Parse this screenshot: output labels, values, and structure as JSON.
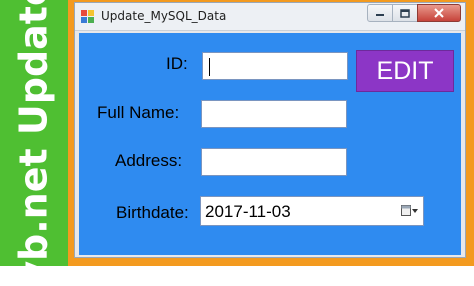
{
  "banner": {
    "text": "vb.net Update"
  },
  "window": {
    "title": "Update_MySQL_Data",
    "controls": {
      "minimize": "minimize",
      "maximize": "maximize",
      "close": "close"
    }
  },
  "form": {
    "id_label": "ID:",
    "id_value": "",
    "fullname_label": "Full Name:",
    "fullname_value": "",
    "address_label": "Address:",
    "address_value": "",
    "birthdate_label": "Birthdate:",
    "birthdate_value": "2017-11-03",
    "edit_button": "EDIT"
  },
  "colors": {
    "banner": "#4fbf32",
    "frame": "#f39a1f",
    "client": "#2f8bf0",
    "edit_button": "#8c36c6"
  }
}
